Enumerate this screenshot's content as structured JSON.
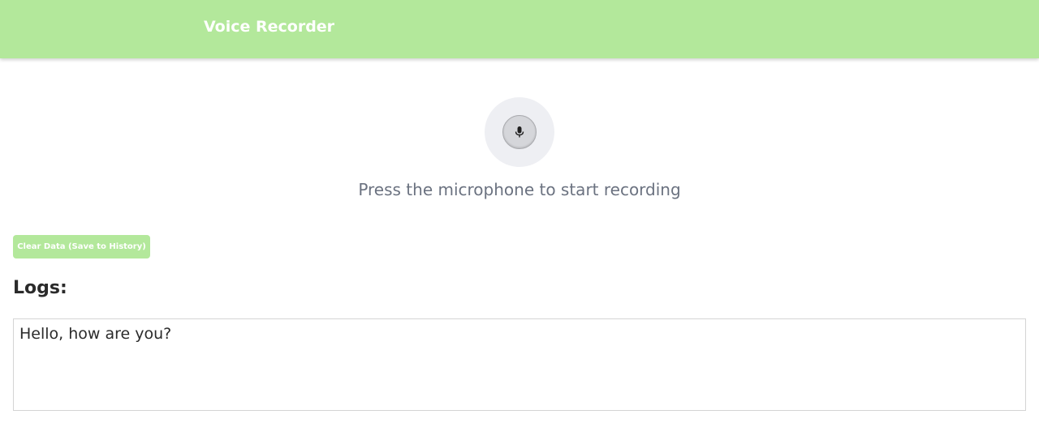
{
  "header": {
    "title": "Voice Recorder",
    "background_color": "#b3e89b"
  },
  "recorder": {
    "icon": "microphone-icon",
    "prompt": "Press the microphone to start recording"
  },
  "actions": {
    "clear_label": "Clear Data (Save to History)"
  },
  "logs": {
    "heading": "Logs:",
    "content": "Hello, how are you?"
  }
}
